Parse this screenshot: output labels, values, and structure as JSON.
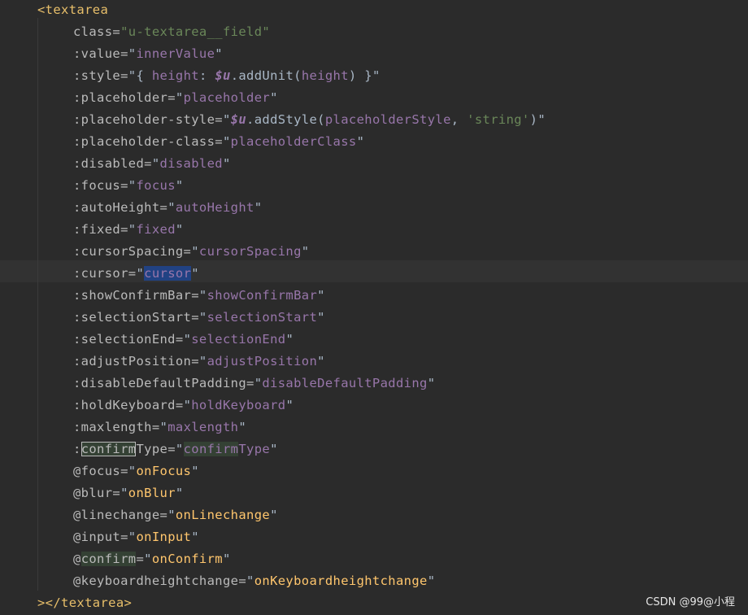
{
  "code": {
    "tag_open": "<textarea",
    "tag_close": "></textarea>",
    "attrs": [
      {
        "name": "class",
        "value": "u-textarea__field"
      },
      {
        "name": ":value",
        "value": "innerValue"
      },
      {
        "name": ":style",
        "value_parts": [
          "{ ",
          "height",
          ": ",
          "$u",
          ".addUnit(",
          "height",
          ") }"
        ]
      },
      {
        "name": ":placeholder",
        "value": "placeholder"
      },
      {
        "name": ":placeholder-style",
        "value_parts": [
          "$u",
          ".addStyle(",
          "placeholderStyle",
          ", ",
          "'string'",
          ")"
        ]
      },
      {
        "name": ":placeholder-class",
        "value": "placeholderClass"
      },
      {
        "name": ":disabled",
        "value": "disabled"
      },
      {
        "name": ":focus",
        "value": "focus"
      },
      {
        "name": ":autoHeight",
        "value": "autoHeight"
      },
      {
        "name": ":fixed",
        "value": "fixed"
      },
      {
        "name": ":cursorSpacing",
        "value": "cursorSpacing"
      },
      {
        "name": ":cursor",
        "value": "cursor"
      },
      {
        "name": ":showConfirmBar",
        "value": "showConfirmBar"
      },
      {
        "name": ":selectionStart",
        "value": "selectionStart"
      },
      {
        "name": ":selectionEnd",
        "value": "selectionEnd"
      },
      {
        "name": ":adjustPosition",
        "value": "adjustPosition"
      },
      {
        "name": ":disableDefaultPadding",
        "value": "disableDefaultPadding"
      },
      {
        "name": ":holdKeyboard",
        "value": "holdKeyboard"
      },
      {
        "name": ":maxlength",
        "value": "maxlength"
      },
      {
        "name_parts": [
          ":",
          "confirm",
          "Type"
        ],
        "value_parts": [
          "confirm",
          "Type"
        ]
      },
      {
        "name": "@focus",
        "value": "onFocus"
      },
      {
        "name": "@blur",
        "value": "onBlur"
      },
      {
        "name": "@linechange",
        "value": "onLinechange"
      },
      {
        "name": "@input",
        "value": "onInput"
      },
      {
        "name_parts": [
          "@",
          "confirm"
        ],
        "value": "onConfirm"
      },
      {
        "name": "@keyboardheightchange",
        "value": "onKeyboardheightchange"
      }
    ],
    "eq": "=",
    "quote": "\""
  },
  "watermark": "CSDN @99@小程",
  "colors": {
    "background": "#2b2b2b",
    "tag": "#e8bf6a",
    "attribute": "#bababa",
    "string": "#6a8759",
    "property": "#9876aa",
    "handler": "#ffc66d",
    "selection": "#214283",
    "occurrence": "#344134"
  }
}
